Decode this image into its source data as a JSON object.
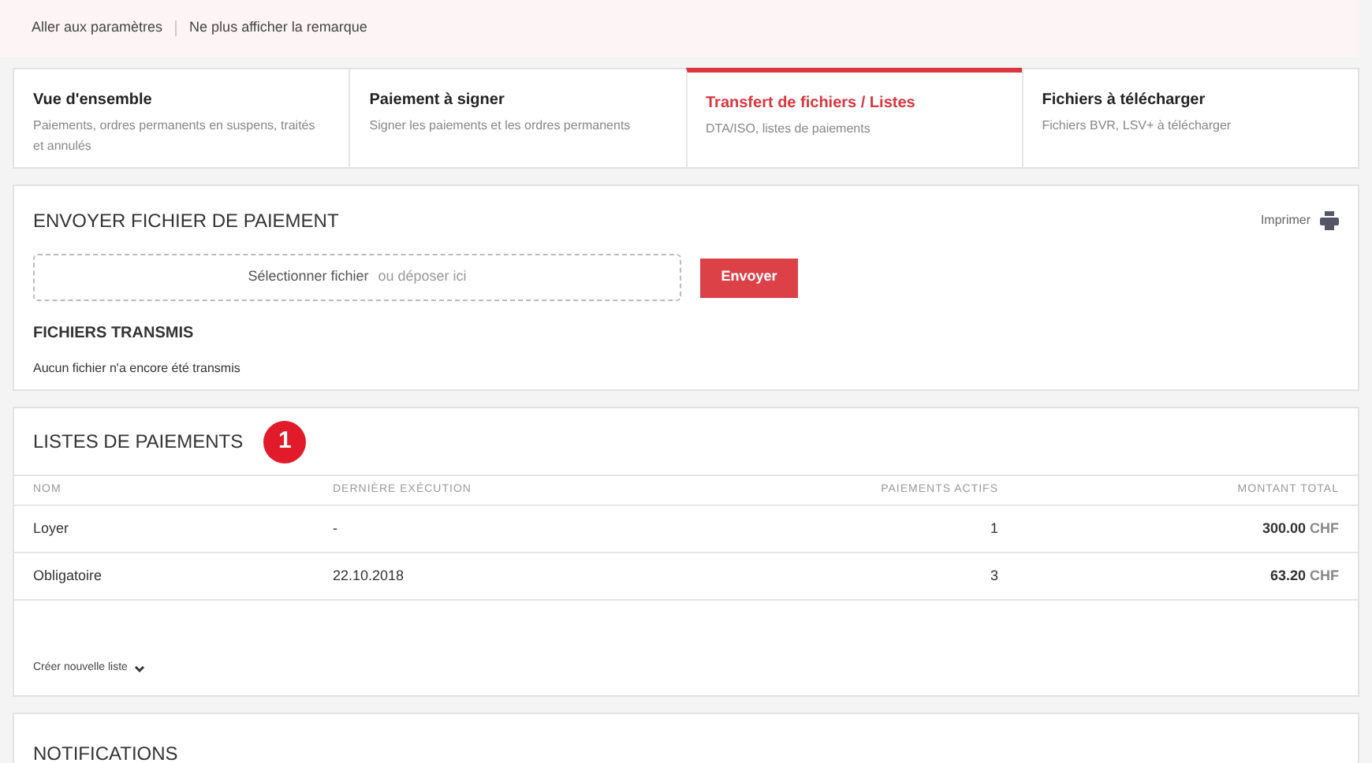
{
  "notice": {
    "links": [
      "Aller aux paramètres",
      "Ne plus afficher la remarque"
    ]
  },
  "tabs": [
    {
      "title": "Vue d'ensemble",
      "subtitle": "Paiements, ordres permanents en suspens, traités et annulés",
      "selected": false
    },
    {
      "title": "Paiement à signer",
      "subtitle": "Signer les paiements et les ordres permanents",
      "selected": false
    },
    {
      "title": "Transfert de fichiers / Listes",
      "subtitle": "DTA/ISO, listes de paiements",
      "selected": true
    },
    {
      "title": "Fichiers à télécharger",
      "subtitle": "Fichiers BVR, LSV+ à télécharger",
      "selected": false
    }
  ],
  "upload": {
    "title": "ENVOYER FICHIER DE PAIEMENT",
    "print": "Imprimer",
    "select": "Sélectionner fichier",
    "drop": "ou déposer ici",
    "send": "Envoyer",
    "sent_title": "FICHIERS TRANSMIS",
    "sent_empty": "Aucun fichier n'a encore été transmis"
  },
  "lists": {
    "title": "LISTES DE PAIEMENTS",
    "badge": "1",
    "columns": [
      "NOM",
      "DERNIÈRE EXÉCUTION",
      "PAIEMENTS ACTIFS",
      "MONTANT TOTAL"
    ],
    "rows": [
      {
        "name": "Loyer",
        "last": "-",
        "active": "1",
        "amount": "300.00",
        "currency": "CHF"
      },
      {
        "name": "Obligatoire",
        "last": "22.10.2018",
        "active": "3",
        "amount": "63.20",
        "currency": "CHF"
      }
    ],
    "create": "Créer nouvelle liste"
  },
  "notifications": {
    "title": "NOTIFICATIONS"
  }
}
